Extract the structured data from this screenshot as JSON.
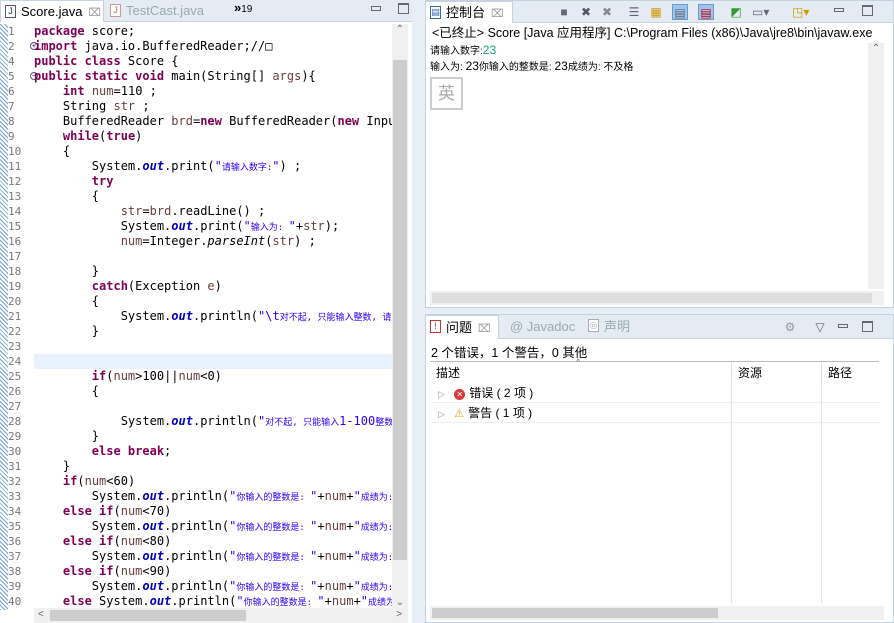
{
  "editor": {
    "tabs": [
      {
        "label": "Score.java",
        "close": "⌧"
      },
      {
        "label": "TestCast.java"
      }
    ],
    "overflow": "»",
    "overflow_count": "19",
    "line_numbers": [
      "1",
      "2",
      "4",
      "5",
      "6",
      "7",
      "8",
      "9",
      "10",
      "11",
      "12",
      "13",
      "14",
      "15",
      "16",
      "17",
      "18",
      "19",
      "20",
      "21",
      "22",
      "23",
      "24",
      "25",
      "26",
      "27",
      "28",
      "29",
      "30",
      "31",
      "32",
      "33",
      "34",
      "35",
      "36",
      "37",
      "38",
      "39",
      "40"
    ],
    "lines": [
      [
        [
          "k",
          "package"
        ],
        [
          "t",
          " score;"
        ]
      ],
      [
        [
          "k",
          "import"
        ],
        [
          "t",
          " java.io.BufferedReader;//□"
        ]
      ],
      [
        [
          "k",
          "public class"
        ],
        [
          "t",
          " Score {"
        ]
      ],
      [
        [
          "k",
          "public static void"
        ],
        [
          "t",
          " main(String[] "
        ],
        [
          "v",
          "args"
        ],
        [
          "t",
          "){"
        ]
      ],
      [
        [
          "t",
          "    "
        ],
        [
          "k",
          "int"
        ],
        [
          "t",
          " "
        ],
        [
          "v",
          "num"
        ],
        [
          "t",
          "=110 ;"
        ]
      ],
      [
        [
          "t",
          "    String "
        ],
        [
          "v",
          "str"
        ],
        [
          "t",
          " ;"
        ]
      ],
      [
        [
          "t",
          "    BufferedReader "
        ],
        [
          "v",
          "brd"
        ],
        [
          "t",
          "="
        ],
        [
          "k",
          "new"
        ],
        [
          "t",
          " BufferedReader("
        ],
        [
          "k",
          "new"
        ],
        [
          "t",
          " InputStreamReader"
        ]
      ],
      [
        [
          "t",
          "    "
        ],
        [
          "k",
          "while"
        ],
        [
          "t",
          "("
        ],
        [
          "k",
          "true"
        ],
        [
          "t",
          ")"
        ]
      ],
      [
        [
          "t",
          "    {"
        ]
      ],
      [
        [
          "t",
          "        System."
        ],
        [
          "i",
          "out"
        ],
        [
          "t",
          ".print("
        ],
        [
          "s",
          "\""
        ],
        [
          "sc",
          "请输入数字:"
        ],
        [
          "s",
          "\""
        ],
        [
          "t",
          ") ;"
        ]
      ],
      [
        [
          "t",
          "        "
        ],
        [
          "k",
          "try"
        ]
      ],
      [
        [
          "t",
          "        {"
        ]
      ],
      [
        [
          "t",
          "            "
        ],
        [
          "v",
          "str"
        ],
        [
          "t",
          "="
        ],
        [
          "v",
          "brd"
        ],
        [
          "t",
          ".readLine() ;"
        ]
      ],
      [
        [
          "t",
          "            System."
        ],
        [
          "i",
          "out"
        ],
        [
          "t",
          ".print("
        ],
        [
          "s",
          "\""
        ],
        [
          "sc",
          "输入为: "
        ],
        [
          "s",
          "\""
        ],
        [
          "t",
          "+"
        ],
        [
          "v",
          "str"
        ],
        [
          "t",
          ");"
        ]
      ],
      [
        [
          "t",
          "            "
        ],
        [
          "v",
          "num"
        ],
        [
          "t",
          "=Integer."
        ],
        [
          "m",
          "parseInt"
        ],
        [
          "t",
          "("
        ],
        [
          "v",
          "str"
        ],
        [
          "t",
          ") ;"
        ]
      ],
      [
        [
          "t",
          ""
        ]
      ],
      [
        [
          "t",
          "        }"
        ]
      ],
      [
        [
          "t",
          "        "
        ],
        [
          "k",
          "catch"
        ],
        [
          "t",
          "(Exception "
        ],
        [
          "v",
          "e"
        ],
        [
          "t",
          ")"
        ]
      ],
      [
        [
          "t",
          "        {"
        ]
      ],
      [
        [
          "t",
          "            System."
        ],
        [
          "i",
          "out"
        ],
        [
          "t",
          ".println("
        ],
        [
          "s",
          "\"\\t"
        ],
        [
          "sc",
          "对不起, 只能输入整数, 请重新输入"
        ]
      ],
      [
        [
          "t",
          "        }"
        ]
      ],
      [
        [
          "t",
          ""
        ]
      ],
      [
        [
          "t",
          ""
        ]
      ],
      [
        [
          "t",
          "        "
        ],
        [
          "k",
          "if"
        ],
        [
          "t",
          "("
        ],
        [
          "v",
          "num"
        ],
        [
          "t",
          ">100||"
        ],
        [
          "v",
          "num"
        ],
        [
          "t",
          "<0)"
        ]
      ],
      [
        [
          "t",
          "        {"
        ]
      ],
      [
        [
          "t",
          ""
        ]
      ],
      [
        [
          "t",
          "            System."
        ],
        [
          "i",
          "out"
        ],
        [
          "t",
          ".println("
        ],
        [
          "s",
          "\""
        ],
        [
          "sc",
          "对不起, 只能输入"
        ],
        [
          "s",
          "1-100"
        ],
        [
          "sc",
          "整数."
        ]
      ],
      [
        [
          "t",
          "        }"
        ]
      ],
      [
        [
          "t",
          "        "
        ],
        [
          "k",
          "else break"
        ],
        [
          "t",
          ";"
        ]
      ],
      [
        [
          "t",
          "    }"
        ]
      ],
      [
        [
          "t",
          "    "
        ],
        [
          "k",
          "if"
        ],
        [
          "t",
          "("
        ],
        [
          "v",
          "num"
        ],
        [
          "t",
          "<60)"
        ]
      ],
      [
        [
          "t",
          "        System."
        ],
        [
          "i",
          "out"
        ],
        [
          "t",
          ".println("
        ],
        [
          "s",
          "\""
        ],
        [
          "sc",
          "你输入的整数是: "
        ],
        [
          "s",
          "\""
        ],
        [
          "t",
          "+"
        ],
        [
          "v",
          "num"
        ],
        [
          "t",
          "+"
        ],
        [
          "s",
          "\""
        ],
        [
          "sc",
          "成绩为:"
        ]
      ],
      [
        [
          "t",
          "    "
        ],
        [
          "k",
          "else if"
        ],
        [
          "t",
          "("
        ],
        [
          "v",
          "num"
        ],
        [
          "t",
          "<70)"
        ]
      ],
      [
        [
          "t",
          "        System."
        ],
        [
          "i",
          "out"
        ],
        [
          "t",
          ".println("
        ],
        [
          "s",
          "\""
        ],
        [
          "sc",
          "你输入的整数是: "
        ],
        [
          "s",
          "\""
        ],
        [
          "t",
          "+"
        ],
        [
          "v",
          "num"
        ],
        [
          "t",
          "+"
        ],
        [
          "s",
          "\""
        ],
        [
          "sc",
          "成绩为:"
        ]
      ],
      [
        [
          "t",
          "    "
        ],
        [
          "k",
          "else if"
        ],
        [
          "t",
          "("
        ],
        [
          "v",
          "num"
        ],
        [
          "t",
          "<80)"
        ]
      ],
      [
        [
          "t",
          "        System."
        ],
        [
          "i",
          "out"
        ],
        [
          "t",
          ".println("
        ],
        [
          "s",
          "\""
        ],
        [
          "sc",
          "你输入的整数是: "
        ],
        [
          "s",
          "\""
        ],
        [
          "t",
          "+"
        ],
        [
          "v",
          "num"
        ],
        [
          "t",
          "+"
        ],
        [
          "s",
          "\""
        ],
        [
          "sc",
          "成绩为:"
        ]
      ],
      [
        [
          "t",
          "    "
        ],
        [
          "k",
          "else if"
        ],
        [
          "t",
          "("
        ],
        [
          "v",
          "num"
        ],
        [
          "t",
          "<90)"
        ]
      ],
      [
        [
          "t",
          "        System."
        ],
        [
          "i",
          "out"
        ],
        [
          "t",
          ".println("
        ],
        [
          "s",
          "\""
        ],
        [
          "sc",
          "你输入的整数是: "
        ],
        [
          "s",
          "\""
        ],
        [
          "t",
          "+"
        ],
        [
          "v",
          "num"
        ],
        [
          "t",
          "+"
        ],
        [
          "s",
          "\""
        ],
        [
          "sc",
          "成绩为:"
        ]
      ],
      [
        [
          "t",
          "    "
        ],
        [
          "k",
          "else"
        ],
        [
          "t",
          " System."
        ],
        [
          "i",
          "out"
        ],
        [
          "t",
          ".println("
        ],
        [
          "s",
          "\""
        ],
        [
          "sc",
          "你输入的整数是: "
        ],
        [
          "s",
          "\""
        ],
        [
          "t",
          "+"
        ],
        [
          "v",
          "num"
        ],
        [
          "t",
          "+"
        ],
        [
          "s",
          "\""
        ],
        [
          "sc",
          "成绩为"
        ]
      ]
    ]
  },
  "console": {
    "tab_label": "控制台",
    "close": "⌧",
    "status": "<已终止> Score [Java 应用程序] C:\\Program Files (x86)\\Java\\jre8\\bin\\javaw.exe",
    "prompt": "请输入数字:",
    "input_value": "23",
    "output_prefix": "输入为: ",
    "output_num1": "23",
    "output_mid": "你输入的整数是: ",
    "output_num2": "23",
    "output_suffix": "成绩为: 不及格",
    "ime_indicator": "英"
  },
  "problems": {
    "tabs": [
      {
        "label": "问题",
        "close": "⌧"
      },
      {
        "label": "@ Javadoc"
      },
      {
        "label": "声明"
      }
    ],
    "summary": "2 个错误，1 个警告，0 其他",
    "columns": [
      "描述",
      "资源",
      "路径"
    ],
    "rows": [
      {
        "label": "错误 ( 2 项 )",
        "type": "error"
      },
      {
        "label": "警告 ( 1 项 )",
        "type": "warning"
      }
    ]
  }
}
